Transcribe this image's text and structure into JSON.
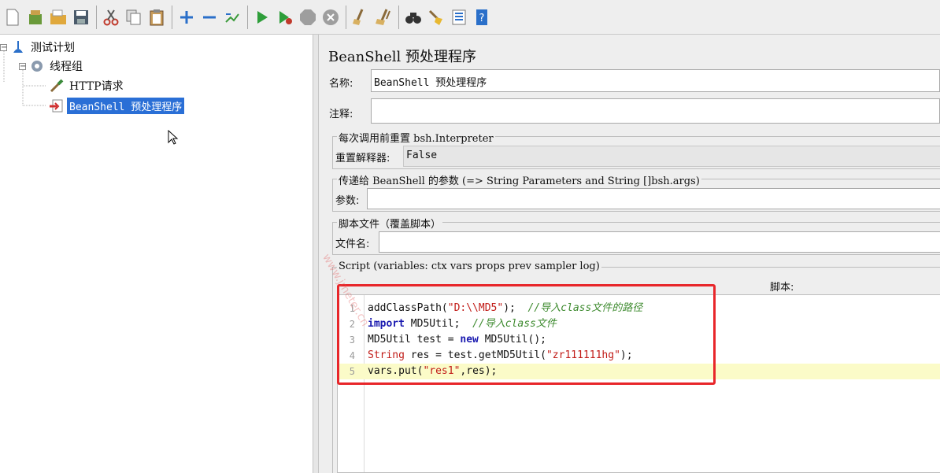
{
  "toolbar": {
    "buttons": [
      "new-icon",
      "templates-icon",
      "open-icon",
      "save-icon",
      "cut-icon",
      "copy-icon",
      "paste-icon",
      "expand-icon",
      "collapse-icon",
      "toggle-icon",
      "start-icon",
      "start-no-pause-icon",
      "stop-icon",
      "shutdown-icon",
      "clear-icon",
      "clear-all-icon",
      "search-icon",
      "reset-search-icon",
      "function-helper-icon",
      "help-icon"
    ]
  },
  "tree": {
    "test_plan": "测试计划",
    "thread_group": "线程组",
    "http_request": "HTTP请求",
    "beanshell": "BeanShell 预处理程序"
  },
  "panel": {
    "title": "BeanShell 预处理程序",
    "name_label": "名称:",
    "name_value": "BeanShell 预处理程序",
    "comment_label": "注释:",
    "comment_value": "",
    "reset_group_title": "每次调用前重置 bsh.Interpreter",
    "reset_label": "重置解释器:",
    "reset_value": "False",
    "params_group_title": "传递给 BeanShell 的参数 (=> String Parameters and String []bsh.args)",
    "params_label": "参数:",
    "params_value": "",
    "file_group_title": "脚本文件（覆盖脚本）",
    "file_label": "文件名:",
    "file_value": "",
    "script_group_title": "Script (variables: ctx vars props prev sampler log)",
    "script_label": "脚本:"
  },
  "script_lines": [
    {
      "n": "1",
      "tokens": [
        [
          "plain",
          "addClassPath("
        ],
        [
          "str",
          "\"D:\\\\MD5\""
        ],
        [
          "plain",
          ");  "
        ],
        [
          "cmt",
          "//导入class文件的路径"
        ]
      ]
    },
    {
      "n": "2",
      "tokens": [
        [
          "kw",
          "import"
        ],
        [
          "plain",
          " MD5Util;  "
        ],
        [
          "cmt",
          "//导入class文件"
        ]
      ]
    },
    {
      "n": "3",
      "tokens": [
        [
          "plain",
          "MD5Util test = "
        ],
        [
          "kw",
          "new"
        ],
        [
          "plain",
          " MD5Util();"
        ]
      ]
    },
    {
      "n": "4",
      "tokens": [
        [
          "str",
          "String"
        ],
        [
          "plain",
          " res = test.getMD5Util("
        ],
        [
          "str",
          "\"zr111111hg\""
        ],
        [
          "plain",
          ");"
        ]
      ]
    },
    {
      "n": "5",
      "tokens": [
        [
          "plain",
          "vars.put("
        ],
        [
          "str",
          "\"res1\""
        ],
        [
          "plain",
          ",res);"
        ]
      ]
    }
  ],
  "watermark": "www.jmeter.cn"
}
